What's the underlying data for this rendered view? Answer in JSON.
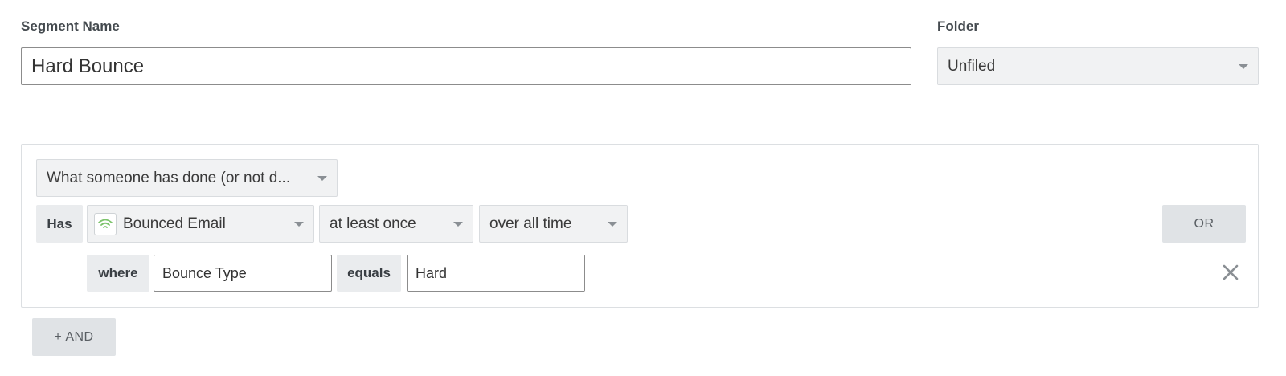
{
  "form": {
    "segment_name_label": "Segment Name",
    "segment_name_value": "Hard Bounce",
    "folder_label": "Folder",
    "folder_value": "Unfiled"
  },
  "condition": {
    "type_select": "What someone has done (or not d...",
    "has_label": "Has",
    "event_select": "Bounced Email",
    "event_icon": "signal-wifi-icon",
    "frequency_select": "at least once",
    "timeframe_select": "over all time",
    "or_button": "OR",
    "filter": {
      "where_label": "where",
      "property_value": "Bounce Type",
      "operator_label": "equals",
      "value": "Hard"
    }
  },
  "actions": {
    "and_button": "+ AND"
  },
  "colors": {
    "accent_green": "#7cc36b",
    "control_gray": "#f1f2f3",
    "chip_gray": "#eaecee",
    "button_gray": "#e0e3e6"
  }
}
